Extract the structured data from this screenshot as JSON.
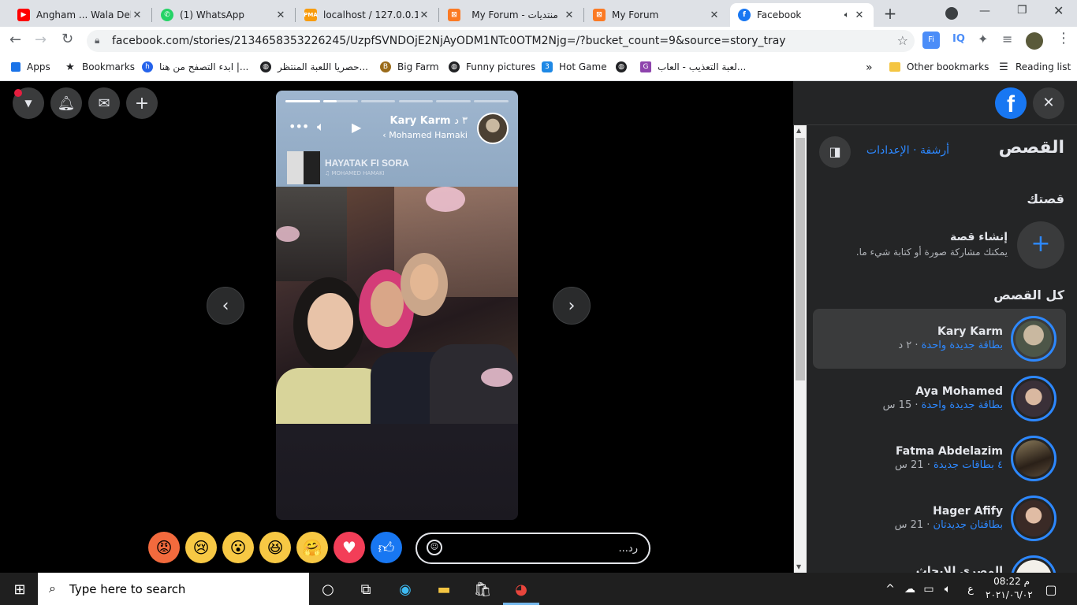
{
  "browser": {
    "tabs": [
      {
        "title": "Angham ... Wala Deble",
        "icon": "youtube-icon",
        "color": "#ff0000"
      },
      {
        "title": "(1) WhatsApp",
        "icon": "whatsapp-icon",
        "color": "#25d366"
      },
      {
        "title": "localhost / 127.0.0.1 /",
        "icon": "phpmyadmin-icon",
        "color": "#f89c0e"
      },
      {
        "title": "My Forum - منتديات",
        "icon": "xampp-icon",
        "color": "#fb7a24"
      },
      {
        "title": "My Forum",
        "icon": "xampp-icon",
        "color": "#fb7a24"
      },
      {
        "title": "Facebook",
        "icon": "facebook-icon",
        "color": "#1877f2"
      }
    ],
    "new_tab": "+",
    "url": "facebook.com/stories/2134658353226245/UzpfSVNDOjE2NjAyODM1NTc0OTM2Njg=/?bucket_count=9&source=story_tray",
    "bookmarks": [
      "Apps",
      "Bookmarks",
      "ابدء التصفح من هنا |...",
      "حصريا اللعبة المنتظر...",
      "Big Farm",
      "Funny pictures",
      "Hot Game",
      "لعبة التعذيب - العاب..."
    ],
    "more_bookmarks": "»",
    "other_bookmarks": "Other bookmarks",
    "reading_list": "Reading list"
  },
  "story": {
    "author": "Kary Karm",
    "time": "٣ د",
    "music_artist": "Mohamed Hamaki",
    "song_title": "HAYATAK FI SORA",
    "song_sub": "♫ MOHAMED HAMAKI",
    "progress_segments": [
      1,
      0.4,
      0,
      0,
      0,
      0
    ],
    "reply_placeholder": "رد...",
    "reactions": [
      "angry-reaction-icon",
      "sad-reaction-icon",
      "wow-reaction-icon",
      "haha-reaction-icon",
      "care-reaction-icon",
      "love-reaction-icon",
      "like-reaction-icon"
    ]
  },
  "sidebar": {
    "title": "القصص",
    "links": "أرشفة · الإعدادات",
    "your_story": "قصتك",
    "create_title": "إنشاء قصة",
    "create_sub": "يمكنك مشاركة صورة أو كتابة شيء ما.",
    "all_stories": "كل القصص",
    "items": [
      {
        "name": "Kary Karm",
        "cards": "بطاقة جديدة واحدة",
        "time": "٢ د"
      },
      {
        "name": "Aya Mohamed",
        "cards": "بطاقة جديدة واحدة",
        "time": "15 س"
      },
      {
        "name": "Fatma Abdelazim",
        "cards": "٤ بطاقات جديدة",
        "time": "21 س"
      },
      {
        "name": "Hager Afify",
        "cards": "بطاقتان جديدتان",
        "time": "21 س"
      },
      {
        "name": "المصري للإبحاث",
        "cards": "",
        "time": ""
      }
    ]
  },
  "taskbar": {
    "search_placeholder": "Type here to search",
    "lang": "ع",
    "time": "08:22 م",
    "date": "٢٠٢١/٠٦/٠٢"
  }
}
